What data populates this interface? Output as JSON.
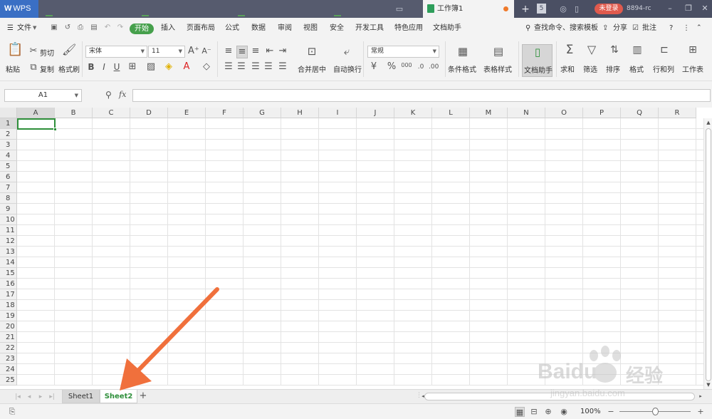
{
  "titlebar": {
    "app_name": "WPS",
    "doc_tab_name": "工作簿1",
    "login_label": "未登录",
    "account_label": "8894-rc",
    "tab_count": "5"
  },
  "menubar": {
    "file_label": "文件",
    "items": [
      "开始",
      "插入",
      "页面布局",
      "公式",
      "数据",
      "审阅",
      "视图",
      "安全",
      "开发工具",
      "特色应用",
      "文档助手"
    ],
    "search_label": "查找命令、搜索模板",
    "share_label": "分享",
    "comment_label": "批注"
  },
  "ribbon": {
    "paste": "粘贴",
    "cut": "剪切",
    "copy": "复制",
    "format_painter": "格式刷",
    "font_name": "宋体",
    "font_size": "11",
    "merge_center": "合并居中",
    "wrap_text": "自动换行",
    "number_format": "常规",
    "conditional_format": "条件格式",
    "table_style": "表格样式",
    "doc_assistant": "文档助手",
    "sum": "求和",
    "filter": "筛选",
    "sort": "排序",
    "format": "格式",
    "row_col": "行和列",
    "worksheet": "工作表",
    "percent_symbol": "%",
    "thousands_symbol": "000"
  },
  "formula_bar": {
    "name_box": "A1",
    "fx_label": "fx",
    "formula_value": ""
  },
  "grid": {
    "columns": [
      "A",
      "B",
      "C",
      "D",
      "E",
      "F",
      "G",
      "H",
      "I",
      "J",
      "K",
      "L",
      "M",
      "N",
      "O",
      "P",
      "Q",
      "R"
    ],
    "rows": [
      "1",
      "2",
      "3",
      "4",
      "5",
      "6",
      "7",
      "8",
      "9",
      "10",
      "11",
      "12",
      "13",
      "14",
      "15",
      "16",
      "17",
      "18",
      "19",
      "20",
      "21",
      "22",
      "23",
      "24",
      "25"
    ],
    "active_cell": "A1"
  },
  "sheets": {
    "tabs": [
      "Sheet1",
      "Sheet2"
    ],
    "active": "Sheet2",
    "add_label": "+"
  },
  "statusbar": {
    "zoom": "100%"
  },
  "colors": {
    "accent_green": "#46a04c",
    "active_tab_text": "#2e8f3a",
    "arrow": "#f0703c",
    "titlebar": "#4a4f63",
    "login_button": "#e05a4d"
  },
  "watermark": {
    "brand": "Baidu",
    "brand_cn": "经验",
    "url": "jingyan.baidu.com"
  }
}
